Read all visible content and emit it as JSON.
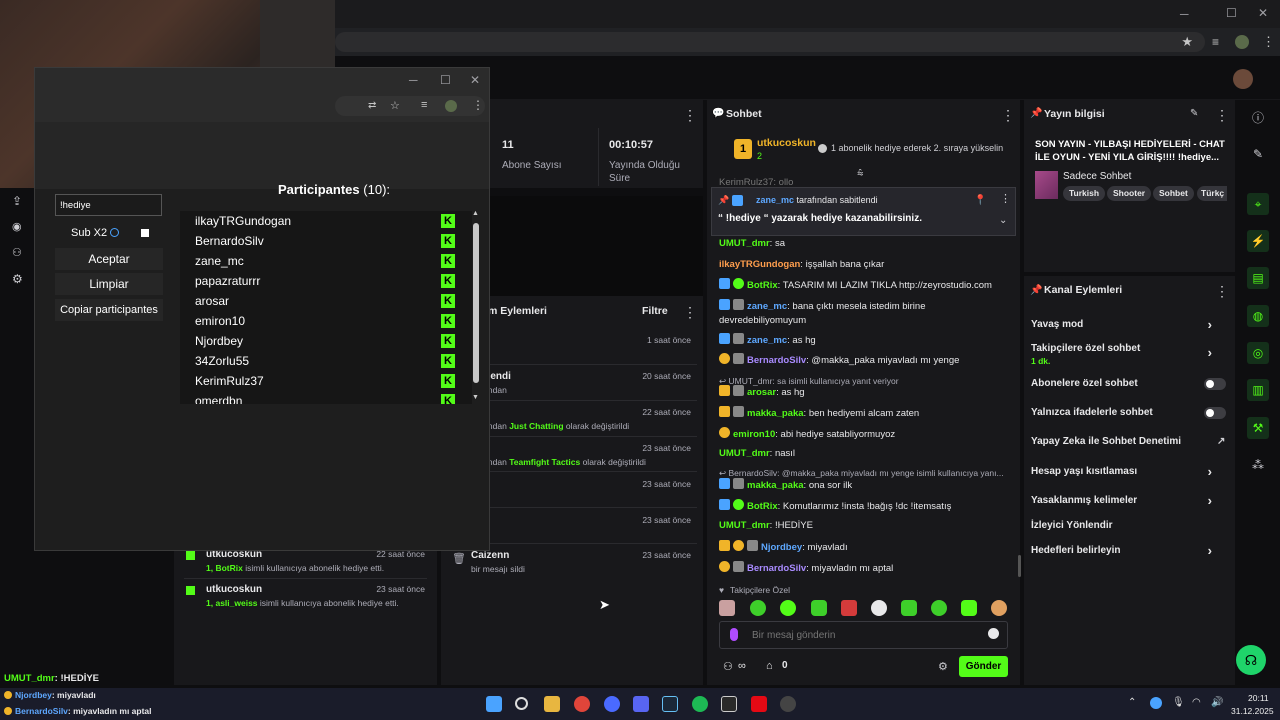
{
  "popup": {
    "title_controls": {
      "minimize": "─",
      "maximize": "☐",
      "close": "✕"
    },
    "filter_value": "!hediye",
    "sub_x2_label": "Sub X2",
    "accept_label": "Aceptar",
    "clear_label": "Limpiar",
    "copy_label": "Copiar participantes",
    "participants_heading": "Participantes",
    "participants_count": "(10):",
    "participants": [
      "ilkayTRGundogan",
      "BernardoSilv",
      "zane_mc",
      "papazraturrr",
      "arosar",
      "emiron10",
      "Njordbey",
      "34Zorlu55",
      "KerimRulz37",
      "omerdbn"
    ]
  },
  "stats": {
    "subs_value": "11",
    "subs_label": "Abone Sayısı",
    "uptime_value": "00:10:57",
    "uptime_label_1": "Yayında Olduğu",
    "uptime_label_2": "Süre"
  },
  "activity": {
    "title": "m Eylemleri",
    "filter_label": "Filtre",
    "items": [
      {
        "title": "enn",
        "sub": "esajı sildi",
        "time": "1 saat önce"
      },
      {
        "title": "aj Sabitlendi",
        "sub_green": "enn",
        "sub": " tarafından",
        "time": "20 saat önce"
      },
      {
        "title": "egori",
        "sub_green": "enn",
        "sub": " tarafından ",
        "sub_link": "Just Chatting",
        "sub_tail": " olarak değiştirildi",
        "time": "22 saat önce"
      },
      {
        "title": "egori",
        "sub_green": "enn",
        "sub": " tarafından ",
        "sub_link": "Teamfight Tactics",
        "sub_tail": " olarak değiştirildi",
        "time": "23 saat önce"
      },
      {
        "title": "enn",
        "sub": "esajı sildi",
        "time": "23 saat önce"
      },
      {
        "title": "enn",
        "sub": "esajı sildi",
        "time": "23 saat önce"
      },
      {
        "title": "Caizenn",
        "sub": "bir mesajı sildi",
        "time": "23 saat önce"
      }
    ]
  },
  "subs_feed": [
    {
      "user": "utkucoskun",
      "detail_num": "1,",
      "detail_user": "BotRix",
      "detail_text": " isimli kullanıcıya abonelik hediye etti.",
      "time": "22 saat önce"
    },
    {
      "user": "utkucoskun",
      "detail_num": "1,",
      "detail_user": "asli_weiss",
      "detail_text": " isimli kullanıcıya abonelik hediye etti.",
      "time": "23 saat önce"
    }
  ],
  "chat": {
    "title": "Sohbet",
    "top_user": "utkucoskun",
    "top_user_count": "2",
    "top_event": "1 abonelik hediye ederek 2. sıraya yükselin",
    "partial_line": "KerimRulz37: ollo",
    "pinned_by_user": "zane_mc",
    "pinned_by_text": "tarafından sabitlendi",
    "pinned_message": "“ !hediye “ yazarak hediye kazanabilirsiniz.",
    "messages": [
      {
        "user": "UMUT_dmr",
        "color": "#53fc18",
        "text": "sa"
      },
      {
        "user": "ilkayTRGundogan",
        "color": "#ff9e4d",
        "text": "işşallah bana çıkar"
      },
      {
        "user": "BotRix",
        "color": "#53fc18",
        "text": "TASARIM MI LAZIM TIKLA http://zeyrostudio.com"
      },
      {
        "user": "zane_mc",
        "color": "#5ea8ff",
        "text": "bana çıktı mesela istedim birine devredebiliyomuyum"
      },
      {
        "user": "zane_mc",
        "color": "#5ea8ff",
        "text": "as hg"
      },
      {
        "user": "BernardoSilv",
        "color": "#a98bff",
        "text": "@makka_paka miyavladı mı yenge"
      },
      {
        "user": "",
        "color": "#adadb8",
        "text": "↩ UMUT_dmr: sa isimli kullanıcıya yanıt veriyor"
      },
      {
        "user": "arosar",
        "color": "#53fc18",
        "text": "as hg"
      },
      {
        "user": "makka_paka",
        "color": "#53fc18",
        "text": "ben hediyemi alcam zaten"
      },
      {
        "user": "emiron10",
        "color": "#53fc18",
        "text": "abi hediye satabliyormuyoz"
      },
      {
        "user": "UMUT_dmr",
        "color": "#53fc18",
        "text": "nasıl"
      },
      {
        "user": "",
        "color": "#adadb8",
        "text": "↩ BernardoSilv: @makka_paka miyavladı mı yenge isimli kullanıcıya yanı..."
      },
      {
        "user": "makka_paka",
        "color": "#53fc18",
        "text": "ona sor ilk"
      },
      {
        "user": "BotRix",
        "color": "#53fc18",
        "text": "Komutlarımız !insta !bağış !dc !itemsatış"
      },
      {
        "user": "UMUT_dmr",
        "color": "#53fc18",
        "text": "!HEDİYE"
      },
      {
        "user": "Njordbey",
        "color": "#5ea8ff",
        "text": "miyavladı"
      },
      {
        "user": "BernardoSilv",
        "color": "#a98bff",
        "text": "miyavladın mı aptal"
      }
    ],
    "followers_only": "Takipçilere Özel",
    "input_placeholder": "Bir mesaj gönderin",
    "points_count": "0",
    "send_label": "Gönder"
  },
  "stream_info": {
    "title": "Yayın bilgisi",
    "stream_title": "SON YAYIN - YILBAŞI HEDİYELERİ - CHAT İLE OYUN - YENİ YILA GİRİŞ!!!! !hediye...",
    "category": "Sadece Sohbet",
    "tags": [
      "Turkish",
      "Shooter",
      "Sohbet",
      "Türkç"
    ]
  },
  "channel_actions": {
    "title": "Kanal Eylemleri",
    "items": [
      {
        "label": "Yavaş mod",
        "kind": "chevron"
      },
      {
        "label": "Takipçilere özel sohbet",
        "sub": "1 dk.",
        "kind": "chevron"
      },
      {
        "label": "Abonelere özel sohbet",
        "kind": "toggle"
      },
      {
        "label": "Yalnızca ifadelerle sohbet",
        "kind": "toggle"
      },
      {
        "label": "Yapay Zeka ile Sohbet Denetimi",
        "kind": "external"
      },
      {
        "label": "Hesap yaşı kısıtlaması",
        "kind": "chevron"
      },
      {
        "label": "Yasaklanmış kelimeler",
        "kind": "chevron"
      },
      {
        "label": "İzleyici Yönlendir",
        "kind": "none"
      },
      {
        "label": "Hedefleri belirleyin",
        "kind": "chevron"
      }
    ]
  },
  "overlay_chat": [
    {
      "user": "UMUT_dmr",
      "text": ": !HEDİYE"
    },
    {
      "user": "Njordbey",
      "text": ": miyavladı"
    },
    {
      "user": "BernardoSilv",
      "text": ": miyavladın mı aptal"
    }
  ],
  "taskbar": {
    "time": "20:11",
    "date": "31.12.2025"
  },
  "colors": {
    "brand": "#53fc18",
    "panel": "#18181b",
    "background": "#0e0e10"
  }
}
